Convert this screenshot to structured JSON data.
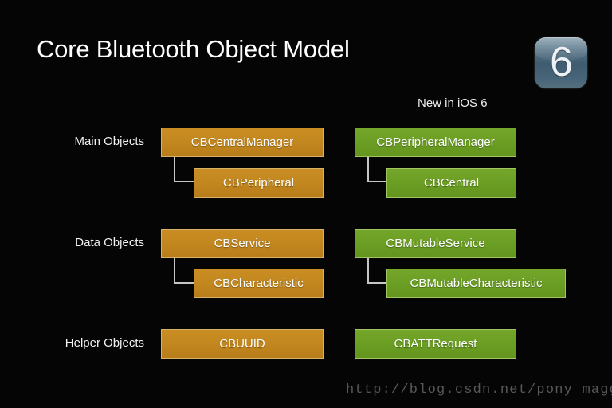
{
  "slide": {
    "title": "Core Bluetooth Object Model",
    "background_color": "#050505",
    "badge": {
      "name": "ios-version-badge",
      "number": "6",
      "color": "#47647a"
    },
    "new_in_caption": "New in iOS 6",
    "watermark": "http://blog.csdn.net/pony_maggie"
  },
  "colors": {
    "orange_fill": "#c2871f",
    "orange_border": "#d7b269",
    "green_fill": "#6b9e24",
    "green_border": "#a2c463",
    "connector": "#c6c6c6",
    "text": "#ffffff",
    "watermark": "#585858"
  },
  "rows": [
    {
      "label": "Main Objects",
      "existing": {
        "parent": "CBCentralManager",
        "child": "CBPeripheral"
      },
      "new_in_ios6": {
        "parent": "CBPeripheralManager",
        "child": "CBCentral"
      }
    },
    {
      "label": "Data Objects",
      "existing": {
        "parent": "CBService",
        "child": "CBCharacteristic"
      },
      "new_in_ios6": {
        "parent": "CBMutableService",
        "child": "CBMutableCharacteristic"
      }
    },
    {
      "label": "Helper Objects",
      "existing": {
        "parent": "CBUUID",
        "child": null
      },
      "new_in_ios6": {
        "parent": "CBATTRequest",
        "child": null
      }
    }
  ]
}
